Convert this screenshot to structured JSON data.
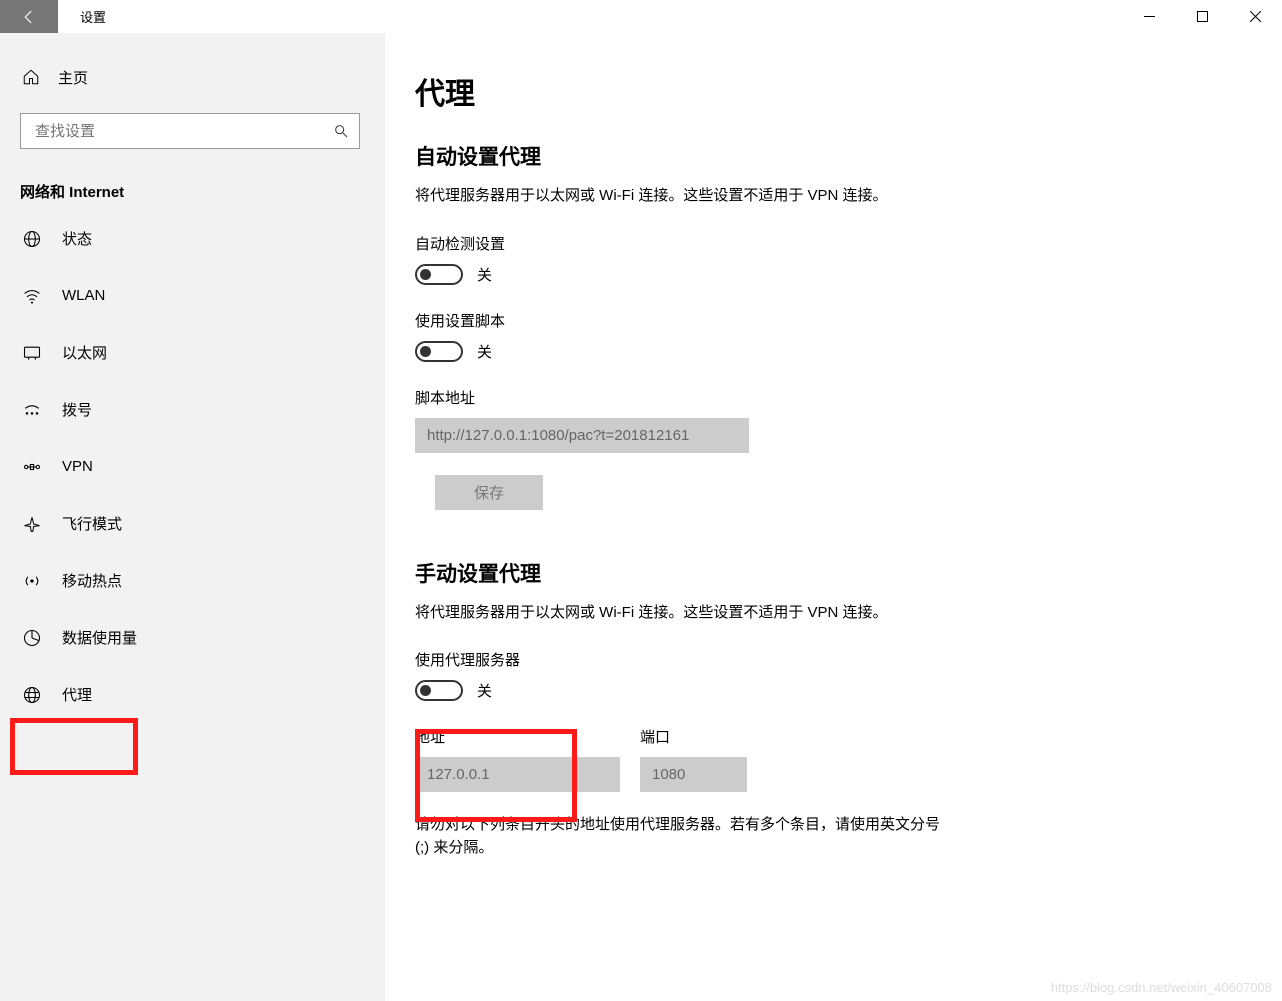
{
  "titlebar": {
    "title": "设置"
  },
  "sidebar": {
    "home": "主页",
    "search_placeholder": "查找设置",
    "section": "网络和 Internet",
    "items": [
      {
        "label": "状态",
        "icon": "status"
      },
      {
        "label": "WLAN",
        "icon": "wifi"
      },
      {
        "label": "以太网",
        "icon": "ethernet"
      },
      {
        "label": "拨号",
        "icon": "dialup"
      },
      {
        "label": "VPN",
        "icon": "vpn"
      },
      {
        "label": "飞行模式",
        "icon": "airplane"
      },
      {
        "label": "移动热点",
        "icon": "hotspot"
      },
      {
        "label": "数据使用量",
        "icon": "data"
      },
      {
        "label": "代理",
        "icon": "proxy"
      }
    ]
  },
  "content": {
    "page_title": "代理",
    "auto": {
      "title": "自动设置代理",
      "description": "将代理服务器用于以太网或 Wi-Fi 连接。这些设置不适用于 VPN 连接。",
      "detect_label": "自动检测设置",
      "detect_state": "关",
      "script_toggle_label": "使用设置脚本",
      "script_toggle_state": "关",
      "script_addr_label": "脚本地址",
      "script_addr_value": "http://127.0.0.1:1080/pac?t=201812161",
      "save_btn": "保存"
    },
    "manual": {
      "title": "手动设置代理",
      "description": "将代理服务器用于以太网或 Wi-Fi 连接。这些设置不适用于 VPN 连接。",
      "use_proxy_label": "使用代理服务器",
      "use_proxy_state": "关",
      "addr_label": "地址",
      "addr_value": "127.0.0.1",
      "port_label": "端口",
      "port_value": "1080",
      "bypass_text": "请勿对以下列条目开头的地址使用代理服务器。若有多个条目，请使用英文分号 (;) 来分隔。"
    }
  },
  "watermark": "https://blog.csdn.net/weixin_40607008"
}
